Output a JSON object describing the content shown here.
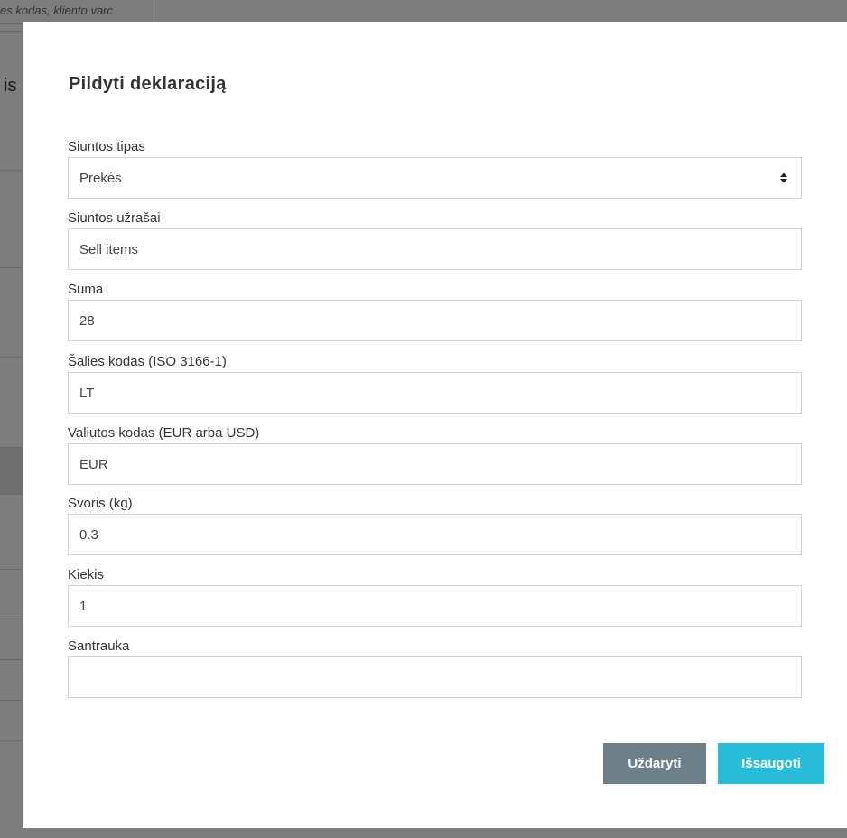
{
  "background": {
    "search_hint": "es kodas, kliento varc",
    "sidebar_text": "is"
  },
  "modal": {
    "title": "Pildyti deklaraciją",
    "fields": {
      "shipment_type": {
        "label": "Siuntos tipas",
        "value": "Prekės"
      },
      "shipment_notes": {
        "label": "Siuntos užrašai",
        "value": "Sell items"
      },
      "amount": {
        "label": "Suma",
        "value": "28"
      },
      "country_code": {
        "label": "Šalies kodas (ISO 3166-1)",
        "value": "LT"
      },
      "currency_code": {
        "label": "Valiutos kodas (EUR arba USD)",
        "value": "EUR"
      },
      "weight": {
        "label": "Svoris (kg)",
        "value": "0.3"
      },
      "quantity": {
        "label": "Kiekis",
        "value": "1"
      },
      "summary": {
        "label": "Santrauka",
        "value": ""
      }
    },
    "buttons": {
      "close_label": "Uždaryti",
      "save_label": "Išsaugoti"
    }
  },
  "colors": {
    "close_button": "#6d7f88",
    "save_button": "#29bcd8",
    "overlay": "#808080"
  },
  "icons": {
    "select_caret": "sort-caret-icon"
  }
}
